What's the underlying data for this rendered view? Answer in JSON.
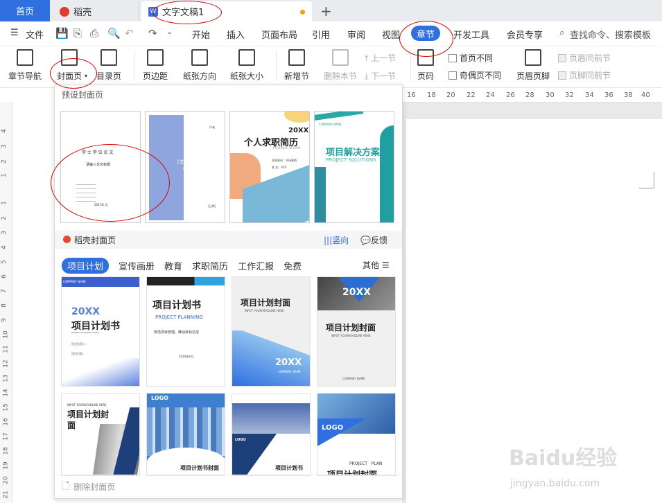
{
  "tabs": {
    "home": "首页",
    "daoke": "稻壳",
    "doc": "文字文稿1"
  },
  "menu": {
    "file": "文件",
    "items": [
      "开始",
      "插入",
      "页面布局",
      "引用",
      "审阅",
      "视图"
    ],
    "active": "章节",
    "after": [
      "开发工具",
      "会员专享"
    ],
    "search": "查找命令、搜索模板"
  },
  "ribbon": {
    "chapter_nav": "章节导航",
    "cover_page": "封面页",
    "toc_page": "目录页",
    "margins": "页边距",
    "orientation": "纸张方向",
    "paper_size": "纸张大小",
    "new_section": "新增节",
    "delete_section": "删除本节",
    "prev_section": "上一节",
    "next_section": "下一节",
    "page_number": "页码",
    "first_page_diff": "首页不同",
    "odd_even_diff": "奇偶页不同",
    "header_footer": "页眉页脚",
    "header_same": "页眉同前节",
    "footer_same": "页脚同前节"
  },
  "ruler_top": [
    "16",
    "18",
    "20",
    "22",
    "24",
    "26",
    "28",
    "30",
    "32",
    "34",
    "36",
    "38",
    "40"
  ],
  "ruler_left": [
    "4",
    "3",
    "2",
    "1",
    "1",
    "2",
    "3",
    "4",
    "5",
    "6",
    "7",
    "8",
    "9",
    "10",
    "11",
    "12",
    "13",
    "14",
    "15",
    "16",
    "17",
    "18",
    "19",
    "20",
    "21"
  ],
  "panel": {
    "preset_title": "预设封面页",
    "presets": [
      {
        "line1": "学 士 学 位 论 文",
        "line2": "请输入论文标题",
        "date": "2017年 月"
      },
      {
        "title": "[文档标题]",
        "sub": "[文档副标题]",
        "author": "作者",
        "date": "[日期]"
      },
      {
        "year": "20XX",
        "title": "个人求职简历",
        "sub": "PERSONAL RESUME",
        "line1": "求职意向：市场营销",
        "line2": "姓  名：XXX"
      },
      {
        "company": "COMPANY NAME",
        "title": "项目解决方案",
        "sub": "PROJECT SOLUTIONS"
      }
    ],
    "daoke_title": "稻壳封面页",
    "vertical": "竖向",
    "feedback": "反馈",
    "categories": [
      "项目计划",
      "宣传画册",
      "教育",
      "求职简历",
      "工作汇报",
      "免费"
    ],
    "more": "其他",
    "templates": [
      {
        "title": "项目计划书",
        "year": "20XX",
        "sub": "PROJECT PLANNING PAPER",
        "company": "COMPANY NAME",
        "line1": "项目负责人：",
        "line2": "项目日期："
      },
      {
        "title": "项目计划书",
        "sub": "PROJECT PLANNING",
        "desc": "规范项目管理，推动目标达成",
        "date": "201X年X月"
      },
      {
        "title": "项目计划封面",
        "sub": "INPUT YOURHEADLINE HERE",
        "year": "20XX",
        "company": "COMPANY NAME"
      },
      {
        "year": "20XX",
        "title": "项目计划封面",
        "sub": "INPUT YOURHEADLINE HERE",
        "company": "COMPANY NAME"
      },
      {
        "sub": "INPUT YOURHEADLINE HERE",
        "title": "项目计划封面"
      },
      {
        "logo": "LOGO",
        "title": "项目计划书封面"
      },
      {
        "logo": "LOGO",
        "title": "项目计划书"
      },
      {
        "logo": "LOGO",
        "sub": "PROJECT   PLAN",
        "title": "项目计划封面"
      }
    ],
    "delete": "删除封面页"
  },
  "watermark": {
    "brand": "Baidu经验",
    "url": "jingyan.baidu.com"
  }
}
